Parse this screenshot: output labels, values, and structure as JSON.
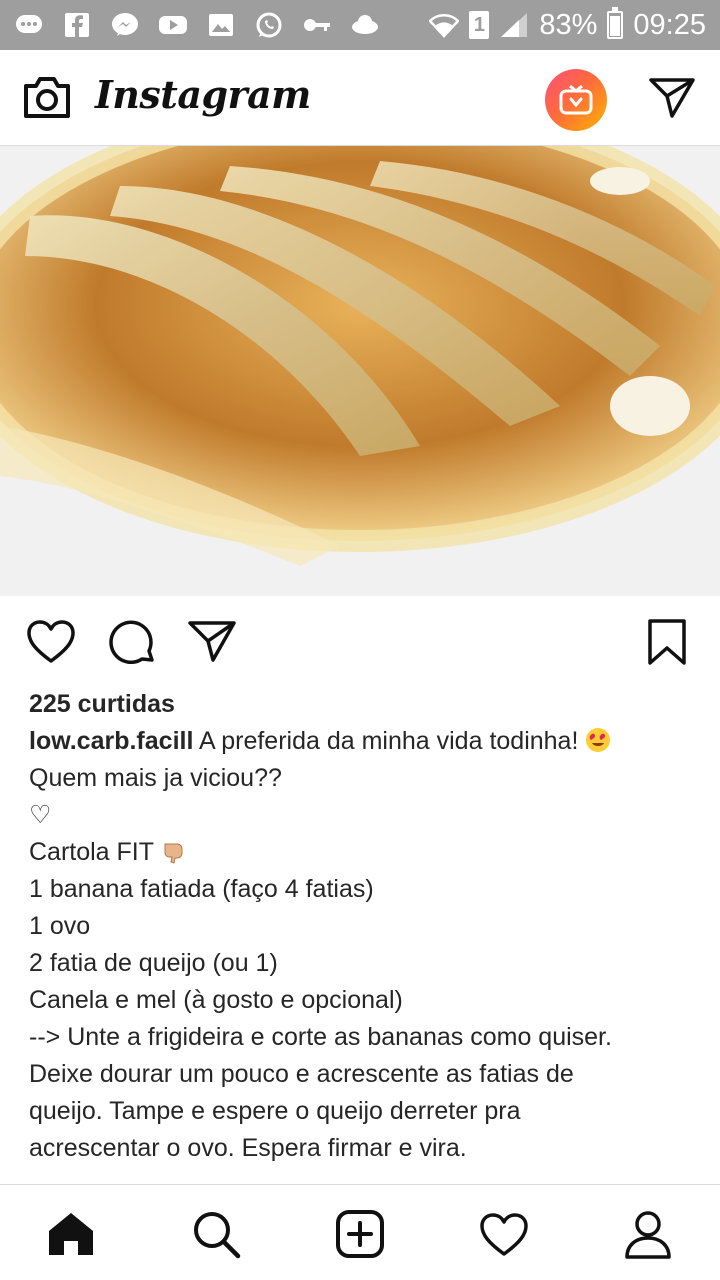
{
  "status_bar": {
    "battery": "83%",
    "battery_level": 0.83,
    "time": "09:25",
    "sim_slot": "1",
    "notification_icons": [
      "chat-bubble-icon",
      "facebook-icon",
      "messenger-icon",
      "youtube-icon",
      "gallery-icon",
      "whatsapp-icon",
      "key-icon",
      "cloud-icon"
    ]
  },
  "header": {
    "logo_text": "Instagram",
    "igtv_accent": "#ff5a5f"
  },
  "post": {
    "image_description_icon": "photo",
    "likes": "225 curtidas",
    "username": "low.carb.facill",
    "caption_lines": [
      "Quem mais ja viciou??",
      "♡",
      "Cartola FIT",
      "1 banana fatiada (faço 4 fatias)",
      "1 ovo",
      "2 fatia de queijo (ou 1)",
      "Canela e mel (à gosto e opcional)",
      "--> Unte a frigideira e corte as bananas como quiser.",
      "Deixe dourar um pouco e acrescente as fatias de",
      "queijo. Tampe e espere o queijo derreter pra",
      "acrescentar o ovo. Espera firmar e vira."
    ],
    "caption_first": "A preferida da minha vida todinha!"
  },
  "bottom_nav": [
    "home-icon",
    "search-icon",
    "new-post-icon",
    "activity-icon",
    "profile-icon"
  ]
}
